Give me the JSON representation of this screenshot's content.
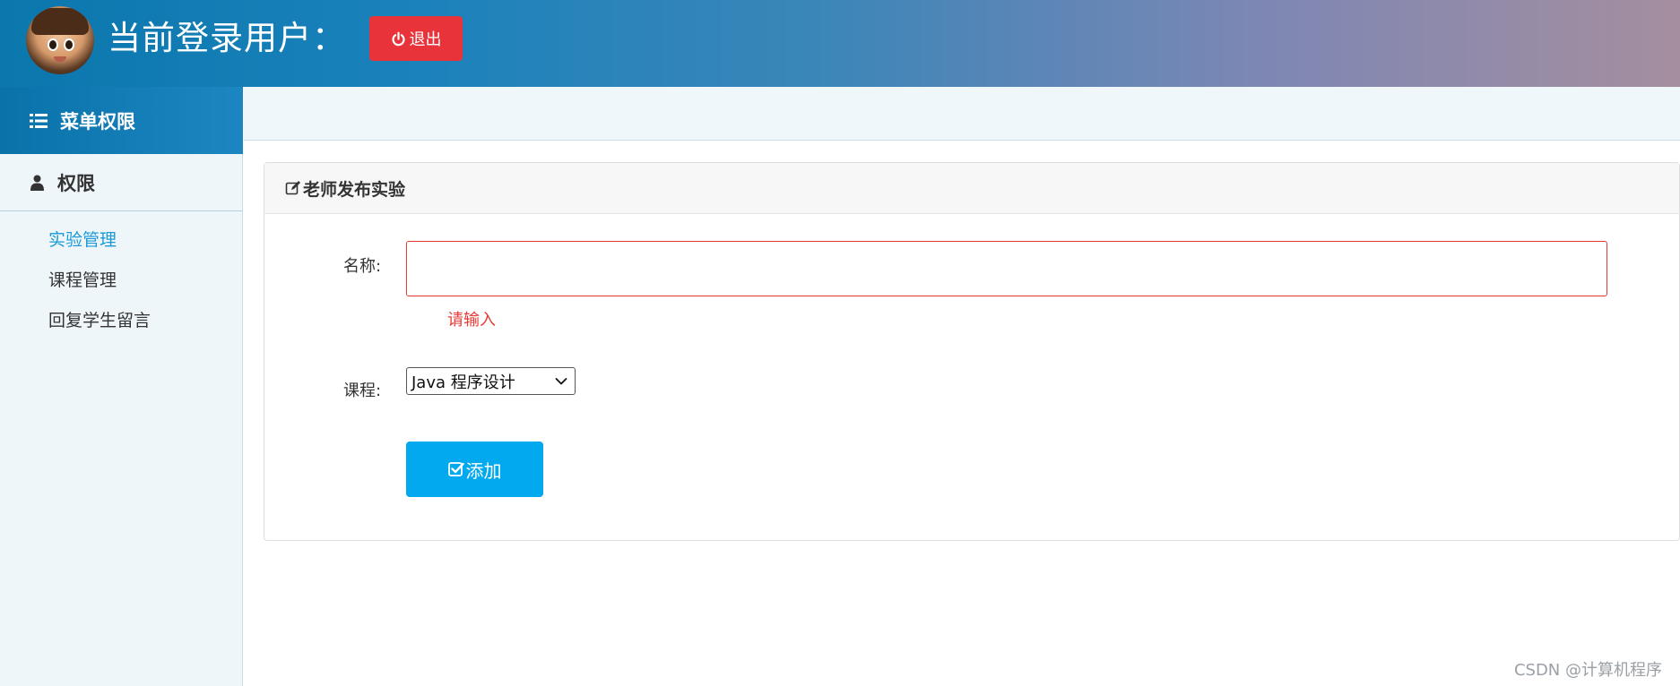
{
  "header": {
    "title": "当前登录用户：",
    "logout_label": "退出"
  },
  "sidebar": {
    "heading": "菜单权限",
    "section": "权限",
    "items": [
      {
        "label": "实验管理",
        "active": true
      },
      {
        "label": "课程管理",
        "active": false
      },
      {
        "label": "回复学生留言",
        "active": false
      }
    ]
  },
  "panel": {
    "title": "老师发布实验",
    "name_label": "名称:",
    "name_value": "",
    "name_error": "请输入",
    "course_label": "课程:",
    "course_selected": "Java 程序设计",
    "add_label": "添加"
  },
  "watermark": "CSDN @计算机程序",
  "colors": {
    "logout_button": "#e8333a",
    "add_button": "#03a9ef",
    "active_menu": "#1b9ad6",
    "error": "#e53935"
  }
}
